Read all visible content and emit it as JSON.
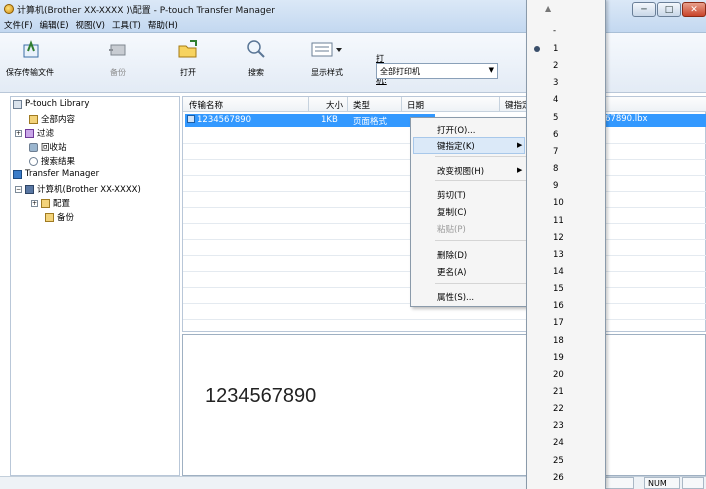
{
  "window": {
    "title": "计算机(Brother  XX-XXXX )\\配置 - P-touch Transfer Manager",
    "controls": [
      "─",
      "□",
      "✕"
    ]
  },
  "menu": [
    "文件(F)",
    "编辑(E)",
    "视图(V)",
    "工具(T)",
    "帮助(H)"
  ],
  "toolbar": {
    "save_transfer": "保存传输文件",
    "backup": "备份",
    "open": "打开",
    "search": "搜索",
    "view_style": "显示样式",
    "printer_label": "打印机:",
    "printer_value": "全部打印机"
  },
  "tree": [
    "P-touch Library",
    "全部内容",
    "过滤",
    "回收站",
    "搜索结果",
    "Transfer Manager",
    "计算机(Brother  XX-XXXX)",
    "配置",
    "备份"
  ],
  "list": {
    "columns": [
      "传输名称",
      "大小",
      "类型",
      "日期",
      "键指定"
    ],
    "row": {
      "name": "1234567890",
      "size": "1KB",
      "type": "页面格式",
      "file": "67890.lbx"
    }
  },
  "preview": {
    "text": "1234567890"
  },
  "status": {
    "num": "NUM"
  },
  "context_menu": [
    {
      "label": "打开(O)...",
      "disabled": false
    },
    {
      "label": "键指定(K)",
      "disabled": false,
      "submenu": true
    },
    {
      "label": "改变视图(H)",
      "disabled": false,
      "submenu": true
    },
    {
      "label": "剪切(T)",
      "disabled": false
    },
    {
      "label": "复制(C)",
      "disabled": false
    },
    {
      "label": "粘贴(P)",
      "disabled": true
    },
    {
      "label": "删除(D)",
      "disabled": false
    },
    {
      "label": "更名(A)",
      "disabled": false
    },
    {
      "label": "属性(S)...",
      "disabled": false
    }
  ],
  "key_list": {
    "first": "-",
    "items": [
      "1",
      "2",
      "3",
      "4",
      "5",
      "6",
      "7",
      "8",
      "9",
      "10",
      "11",
      "12",
      "13",
      "14",
      "15",
      "16",
      "17",
      "18",
      "19",
      "20",
      "21",
      "22",
      "23",
      "24",
      "25",
      "26"
    ],
    "selected": "1"
  }
}
